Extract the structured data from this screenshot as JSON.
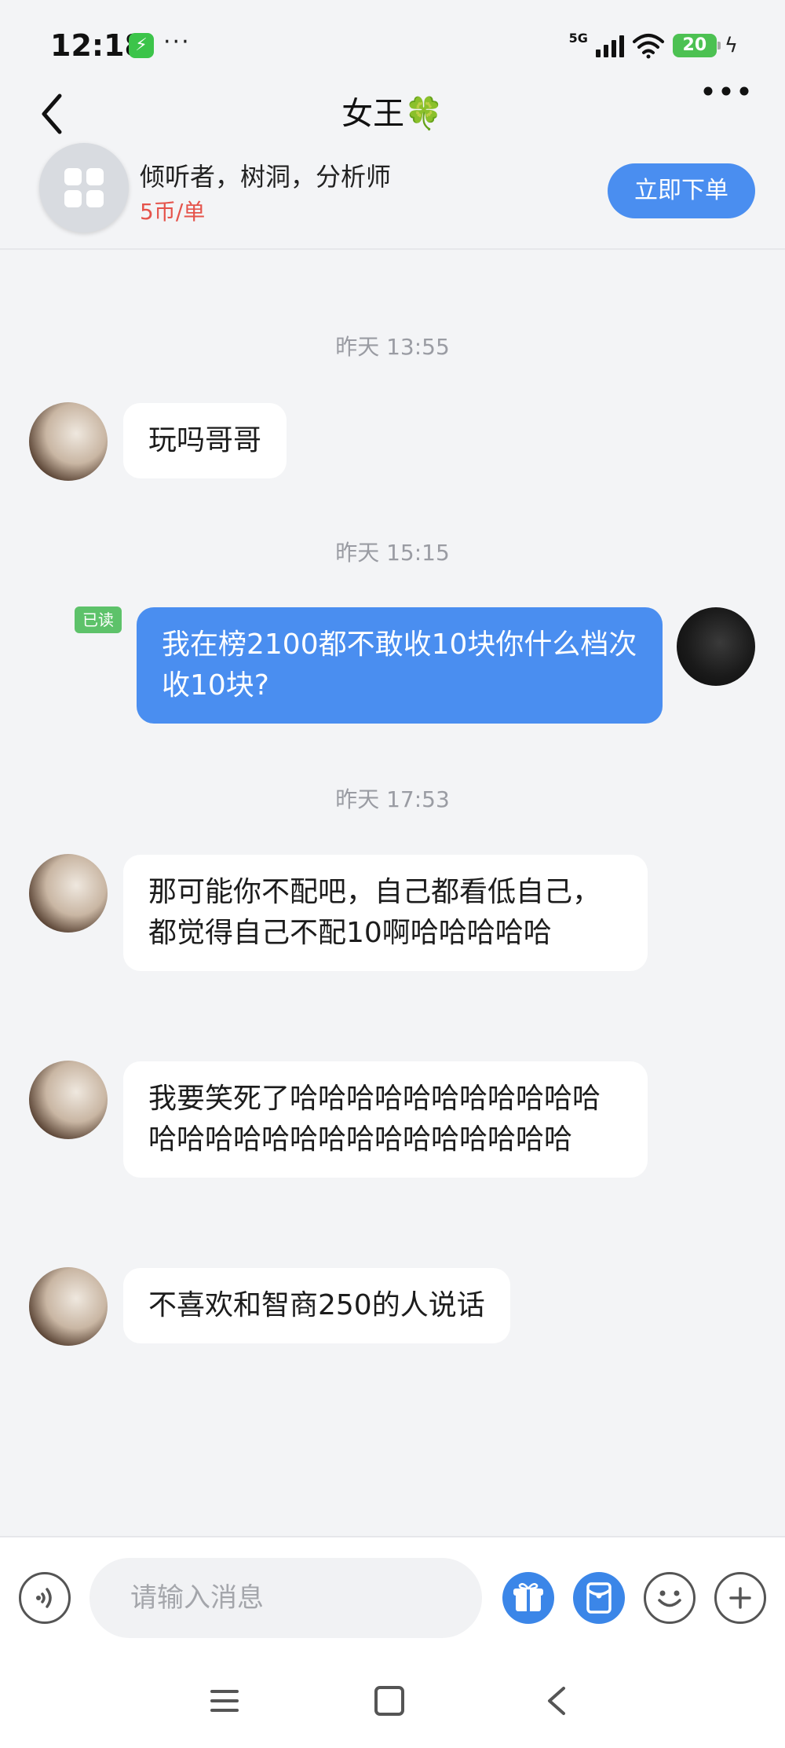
{
  "status_bar": {
    "time": "12:18",
    "network": "5G",
    "battery": "20",
    "dots": "···"
  },
  "header": {
    "title": "女王🍀"
  },
  "service": {
    "name": "倾听者，树洞，分析师",
    "price": "5币/单",
    "order_label": "立即下单"
  },
  "messages": [
    {
      "type": "time",
      "text": "昨天 13:55"
    },
    {
      "type": "in",
      "text": "玩吗哥哥"
    },
    {
      "type": "time",
      "text": "昨天 15:15"
    },
    {
      "type": "out",
      "text": "我在榜2100都不敢收10块你什么档次收10块?",
      "read": "已读"
    },
    {
      "type": "time",
      "text": "昨天 17:53"
    },
    {
      "type": "in",
      "text": "那可能你不配吧，自己都看低自己，都觉得自己不配10啊哈哈哈哈哈"
    },
    {
      "type": "in",
      "text": "我要笑死了哈哈哈哈哈哈哈哈哈哈哈哈哈哈哈哈哈哈哈哈哈哈哈哈哈哈"
    },
    {
      "type": "in",
      "text": "不喜欢和智商250的人说话"
    }
  ],
  "input": {
    "placeholder": "请输入消息"
  },
  "colors": {
    "accent": "#4a8ef0",
    "price": "#e5534b",
    "read_badge": "#5dc26a",
    "background": "#f3f4f6"
  },
  "icons": {
    "back": "chevron-left-icon",
    "more": "more-dots-icon",
    "voice": "voice-icon",
    "gift": "gift-icon",
    "red_packet": "red-packet-icon",
    "emoji": "emoji-icon",
    "plus": "plus-icon"
  }
}
